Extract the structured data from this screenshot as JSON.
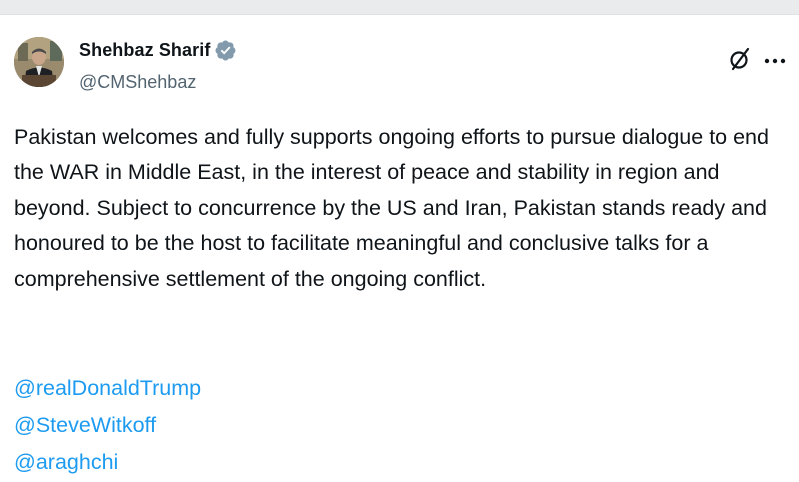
{
  "author": {
    "display_name": "Shehbaz Sharif",
    "handle": "@CMShehbaz",
    "verified_badge_icon": "verified-badge-icon",
    "verified_badge_color": "#829aab"
  },
  "header_actions": {
    "grok_icon": "grok-slash-icon",
    "more_icon": "more-horizontal-icon"
  },
  "tweet": {
    "text": "Pakistan welcomes and fully supports ongoing efforts to pursue dialogue to end the WAR in Middle East, in the interest of peace and stability in region and beyond. Subject to concurrence by the US and Iran, Pakistan stands ready and honoured to be the host to facilitate meaningful and conclusive talks for a comprehensive settlement of the ongoing conflict.",
    "mentions": [
      "@realDonaldTrump",
      "@SteveWitkoff",
      "@araghchi"
    ]
  },
  "colors": {
    "text": "#0f1419",
    "secondary_text": "#536471",
    "link": "#1d9bf0",
    "background": "#ffffff"
  }
}
